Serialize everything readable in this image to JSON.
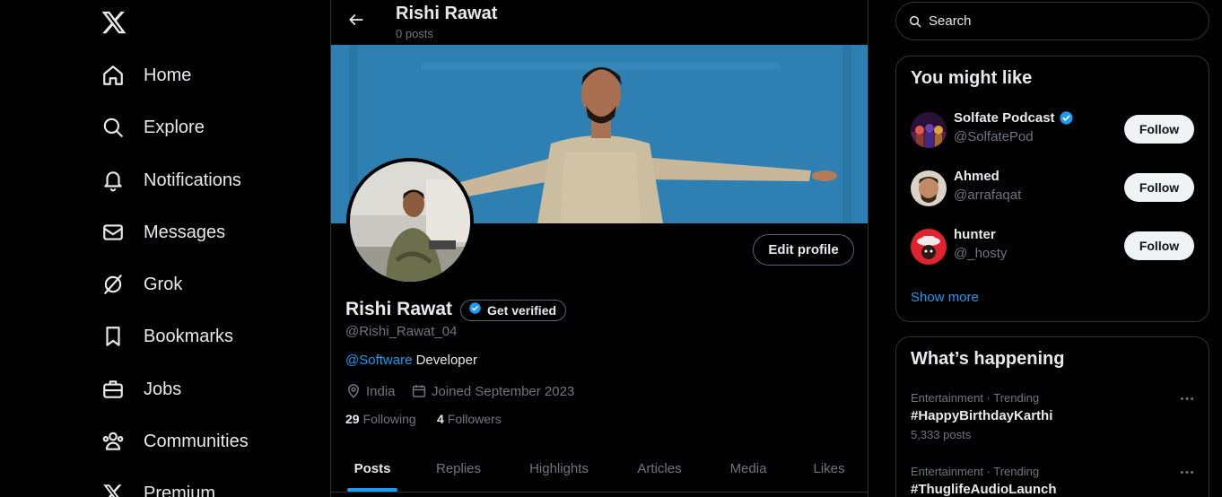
{
  "nav": {
    "items": [
      {
        "label": "Home",
        "icon": "home-icon"
      },
      {
        "label": "Explore",
        "icon": "search-icon"
      },
      {
        "label": "Notifications",
        "icon": "bell-icon"
      },
      {
        "label": "Messages",
        "icon": "envelope-icon"
      },
      {
        "label": "Grok",
        "icon": "grok-icon"
      },
      {
        "label": "Bookmarks",
        "icon": "bookmark-icon"
      },
      {
        "label": "Jobs",
        "icon": "briefcase-icon"
      },
      {
        "label": "Communities",
        "icon": "people-icon"
      },
      {
        "label": "Premium",
        "icon": "x-logo-icon"
      }
    ]
  },
  "header": {
    "name": "Rishi Rawat",
    "post_count": "0 posts"
  },
  "profile": {
    "name": "Rishi Rawat",
    "get_verified_label": "Get verified",
    "handle": "@Rishi_Rawat_04",
    "bio_mention": "@Software",
    "bio_text": " Developer",
    "location": "India",
    "joined": "Joined September 2023",
    "following_count": "29",
    "following_label": "Following",
    "followers_count": "4",
    "followers_label": "Followers",
    "edit_profile_label": "Edit profile"
  },
  "tabs": [
    {
      "label": "Posts",
      "active": true
    },
    {
      "label": "Replies"
    },
    {
      "label": "Highlights"
    },
    {
      "label": "Articles"
    },
    {
      "label": "Media"
    },
    {
      "label": "Likes"
    }
  ],
  "search": {
    "placeholder": "Search"
  },
  "who_to_follow": {
    "title": "You might like",
    "accounts": [
      {
        "name": "Solfate Podcast",
        "handle": "@SolfatePod",
        "verified": true,
        "follow_label": "Follow"
      },
      {
        "name": "Ahmed",
        "handle": "@arrafaqat",
        "verified": false,
        "follow_label": "Follow"
      },
      {
        "name": "hunter",
        "handle": "@_hosty",
        "verified": false,
        "follow_label": "Follow"
      }
    ],
    "show_more": "Show more"
  },
  "trending": {
    "title": "What’s happening",
    "items": [
      {
        "category": "Entertainment · Trending",
        "topic": "#HappyBirthdayKarthi",
        "posts": "5,333 posts"
      },
      {
        "category": "Entertainment · Trending",
        "topic": "#ThuglifeAudioLaunch",
        "posts": ""
      }
    ]
  },
  "colors": {
    "accent": "#1d9bf0",
    "background": "#000000",
    "border": "#2f3336",
    "text_primary": "#e7e9ea",
    "text_secondary": "#71767b"
  }
}
